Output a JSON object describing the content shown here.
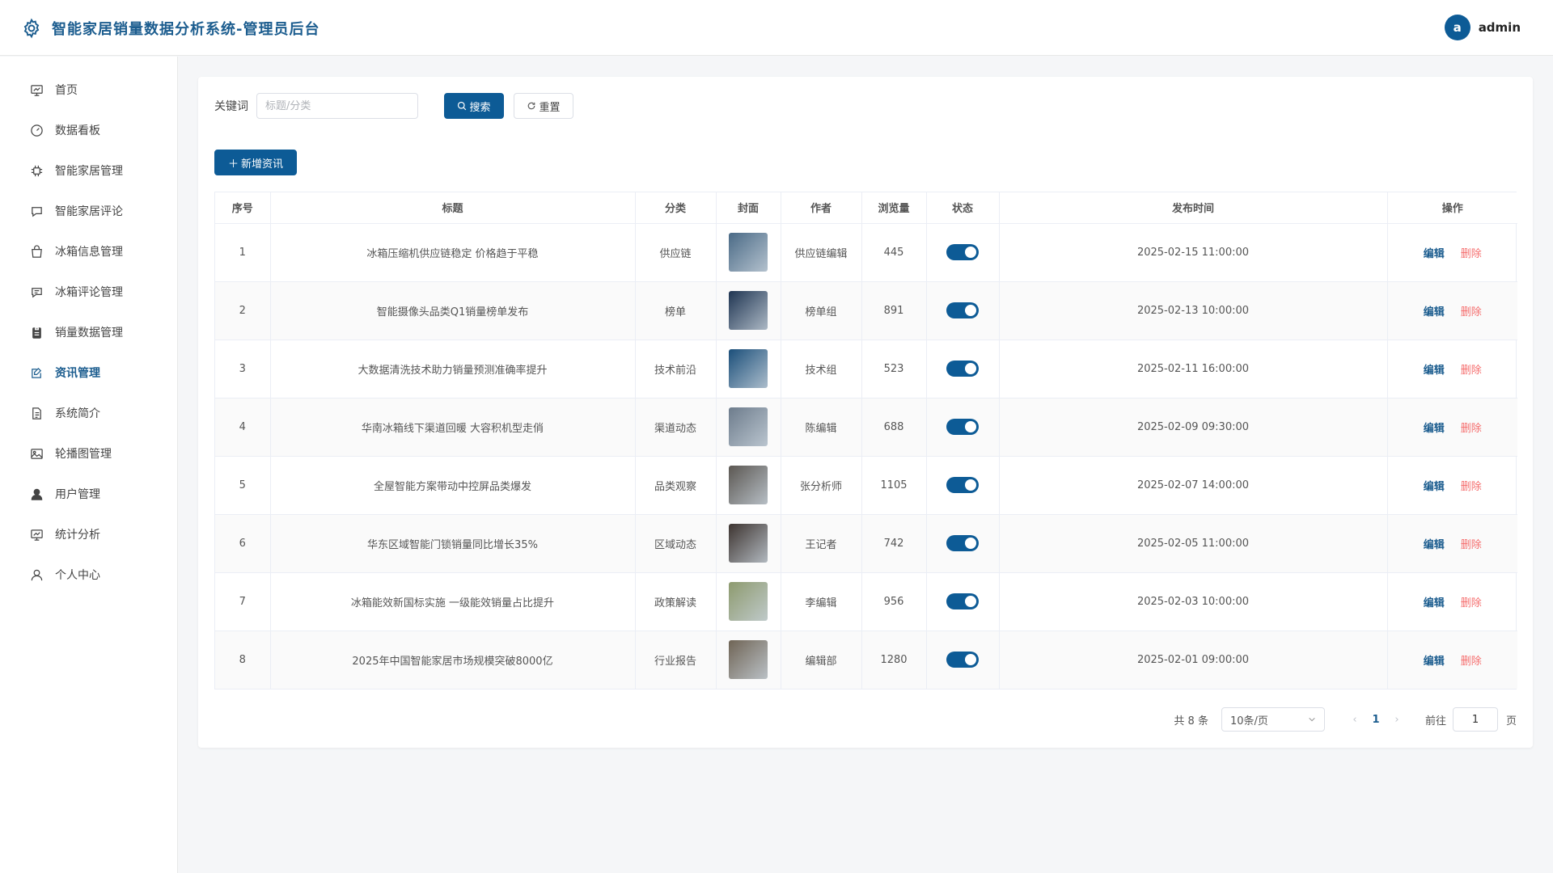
{
  "header": {
    "title": "智能家居销量数据分析系统-管理员后台",
    "logo_icon": "gear-icon",
    "user": {
      "avatar_letter": "a",
      "name": "admin"
    }
  },
  "sidebar": {
    "items": [
      {
        "label": "首页",
        "icon": "presentation-icon",
        "active": false
      },
      {
        "label": "数据看板",
        "icon": "dashboard-icon",
        "active": false
      },
      {
        "label": "智能家居管理",
        "icon": "chip-icon",
        "active": false
      },
      {
        "label": "智能家居评论",
        "icon": "chat-dots-icon",
        "active": false
      },
      {
        "label": "冰箱信息管理",
        "icon": "shopping-bag-icon",
        "active": false
      },
      {
        "label": "冰箱评论管理",
        "icon": "chat-lines-icon",
        "active": false
      },
      {
        "label": "销量数据管理",
        "icon": "clipboard-icon",
        "active": false
      },
      {
        "label": "资讯管理",
        "icon": "news-edit-icon",
        "active": true
      },
      {
        "label": "系统简介",
        "icon": "document-icon",
        "active": false
      },
      {
        "label": "轮播图管理",
        "icon": "picture-icon",
        "active": false
      },
      {
        "label": "用户管理",
        "icon": "user-filled-icon",
        "active": false
      },
      {
        "label": "统计分析",
        "icon": "chart-board-icon",
        "active": false
      },
      {
        "label": "个人中心",
        "icon": "user-outline-icon",
        "active": false
      }
    ]
  },
  "search": {
    "label": "关键词",
    "placeholder": "标题/分类",
    "value": "",
    "search_button": "搜索",
    "reset_button": "重置"
  },
  "toolbar": {
    "add_button": "新增资讯"
  },
  "table": {
    "columns": [
      "序号",
      "标题",
      "分类",
      "封面",
      "作者",
      "浏览量",
      "状态",
      "发布时间",
      "操作"
    ],
    "edit_label": "编辑",
    "delete_label": "删除",
    "rows": [
      {
        "index": "1",
        "title": "冰箱压缩机供应链稳定 价格趋于平稳",
        "category": "供应链",
        "author": "供应链编辑",
        "views": "445",
        "status": true,
        "published": "2025-02-15 11:00:00",
        "cover_color": "#4a6a86"
      },
      {
        "index": "2",
        "title": "智能摄像头品类Q1销量榜单发布",
        "category": "榜单",
        "author": "榜单组",
        "views": "891",
        "status": true,
        "published": "2025-02-13 10:00:00",
        "cover_color": "#1f3552"
      },
      {
        "index": "3",
        "title": "大数据清洗技术助力销量预测准确率提升",
        "category": "技术前沿",
        "author": "技术组",
        "views": "523",
        "status": true,
        "published": "2025-02-11 16:00:00",
        "cover_color": "#1b4f7a"
      },
      {
        "index": "4",
        "title": "华南冰箱线下渠道回暖 大容积机型走俏",
        "category": "渠道动态",
        "author": "陈编辑",
        "views": "688",
        "status": true,
        "published": "2025-02-09 09:30:00",
        "cover_color": "#6d7c8c"
      },
      {
        "index": "5",
        "title": "全屋智能方案带动中控屏品类爆发",
        "category": "品类观察",
        "author": "张分析师",
        "views": "1105",
        "status": true,
        "published": "2025-02-07 14:00:00",
        "cover_color": "#5b5752"
      },
      {
        "index": "6",
        "title": "华东区域智能门锁销量同比增长35%",
        "category": "区域动态",
        "author": "王记者",
        "views": "742",
        "status": true,
        "published": "2025-02-05 11:00:00",
        "cover_color": "#3d3430"
      },
      {
        "index": "7",
        "title": "冰箱能效新国标实施 一级能效销量占比提升",
        "category": "政策解读",
        "author": "李编辑",
        "views": "956",
        "status": true,
        "published": "2025-02-03 10:00:00",
        "cover_color": "#8d9a6e"
      },
      {
        "index": "8",
        "title": "2025年中国智能家居市场规模突破8000亿",
        "category": "行业报告",
        "author": "编辑部",
        "views": "1280",
        "status": true,
        "published": "2025-02-01 09:00:00",
        "cover_color": "#6f6455"
      }
    ]
  },
  "pagination": {
    "total_text": "共 8 条",
    "page_size": "10条/页",
    "current_page": "1",
    "goto_label": "前往",
    "goto_value": "1",
    "page_unit": "页"
  }
}
